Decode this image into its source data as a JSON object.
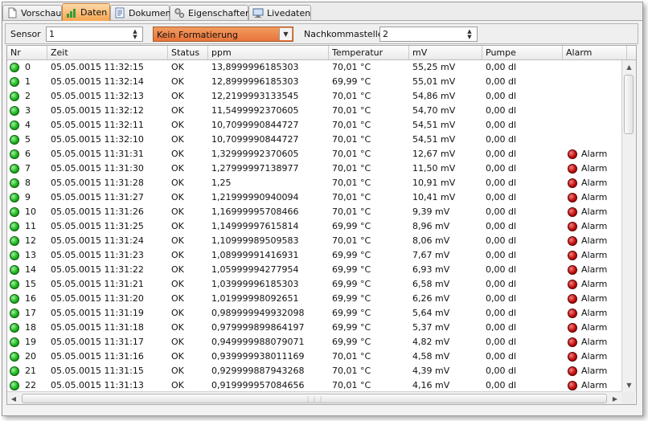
{
  "tabs": [
    {
      "label": "Vorschau",
      "icon": "document-icon"
    },
    {
      "label": "Daten",
      "icon": "bar-chart-icon",
      "active": true
    },
    {
      "label": "Dokument",
      "icon": "document-lines-icon"
    },
    {
      "label": "Eigenschaften",
      "icon": "gears-icon"
    },
    {
      "label": "Livedaten",
      "icon": "monitor-icon"
    }
  ],
  "toolbar": {
    "sensor_label": "Sensor",
    "sensor_value": "1",
    "format_value": "Kein Formatierung",
    "decimals_label": "Nachkommastellen",
    "decimals_value": "2"
  },
  "columns": [
    "Nr",
    "Zeit",
    "Status",
    "ppm",
    "Temperatur",
    "mV",
    "Pumpe",
    "Alarm"
  ],
  "rows": [
    {
      "nr": "0",
      "zeit": "05.05.0015 11:32:15",
      "status": "OK",
      "ppm": "13,8999996185303",
      "temp": "70,01 °C",
      "mv": "55,25 mV",
      "pumpe": "0,00 dl",
      "alarm": ""
    },
    {
      "nr": "1",
      "zeit": "05.05.0015 11:32:14",
      "status": "OK",
      "ppm": "12,8999996185303",
      "temp": "69,99 °C",
      "mv": "55,01 mV",
      "pumpe": "0,00 dl",
      "alarm": ""
    },
    {
      "nr": "2",
      "zeit": "05.05.0015 11:32:13",
      "status": "OK",
      "ppm": "12,2199993133545",
      "temp": "70,01 °C",
      "mv": "54,86 mV",
      "pumpe": "0,00 dl",
      "alarm": ""
    },
    {
      "nr": "3",
      "zeit": "05.05.0015 11:32:12",
      "status": "OK",
      "ppm": "11,5499992370605",
      "temp": "70,01 °C",
      "mv": "54,70 mV",
      "pumpe": "0,00 dl",
      "alarm": ""
    },
    {
      "nr": "4",
      "zeit": "05.05.0015 11:32:11",
      "status": "OK",
      "ppm": "10,7099990844727",
      "temp": "70,01 °C",
      "mv": "54,51 mV",
      "pumpe": "0,00 dl",
      "alarm": ""
    },
    {
      "nr": "5",
      "zeit": "05.05.0015 11:32:10",
      "status": "OK",
      "ppm": "10,7099990844727",
      "temp": "70,01 °C",
      "mv": "54,51 mV",
      "pumpe": "0,00 dl",
      "alarm": ""
    },
    {
      "nr": "6",
      "zeit": "05.05.0015 11:31:31",
      "status": "OK",
      "ppm": "1,32999992370605",
      "temp": "70,01 °C",
      "mv": "12,67 mV",
      "pumpe": "0,00 dl",
      "alarm": "Alarm"
    },
    {
      "nr": "7",
      "zeit": "05.05.0015 11:31:30",
      "status": "OK",
      "ppm": "1,27999997138977",
      "temp": "70,01 °C",
      "mv": "11,50 mV",
      "pumpe": "0,00 dl",
      "alarm": "Alarm"
    },
    {
      "nr": "8",
      "zeit": "05.05.0015 11:31:28",
      "status": "OK",
      "ppm": "1,25",
      "temp": "70,01 °C",
      "mv": "10,91 mV",
      "pumpe": "0,00 dl",
      "alarm": "Alarm"
    },
    {
      "nr": "9",
      "zeit": "05.05.0015 11:31:27",
      "status": "OK",
      "ppm": "1,21999990940094",
      "temp": "70,01 °C",
      "mv": "10,41 mV",
      "pumpe": "0,00 dl",
      "alarm": "Alarm"
    },
    {
      "nr": "10",
      "zeit": "05.05.0015 11:31:26",
      "status": "OK",
      "ppm": "1,16999995708466",
      "temp": "70,01 °C",
      "mv": "9,39 mV",
      "pumpe": "0,00 dl",
      "alarm": "Alarm"
    },
    {
      "nr": "11",
      "zeit": "05.05.0015 11:31:25",
      "status": "OK",
      "ppm": "1,14999997615814",
      "temp": "69,99 °C",
      "mv": "8,96 mV",
      "pumpe": "0,00 dl",
      "alarm": "Alarm"
    },
    {
      "nr": "12",
      "zeit": "05.05.0015 11:31:24",
      "status": "OK",
      "ppm": "1,10999989509583",
      "temp": "70,01 °C",
      "mv": "8,06 mV",
      "pumpe": "0,00 dl",
      "alarm": "Alarm"
    },
    {
      "nr": "13",
      "zeit": "05.05.0015 11:31:23",
      "status": "OK",
      "ppm": "1,08999991416931",
      "temp": "69,99 °C",
      "mv": "7,67 mV",
      "pumpe": "0,00 dl",
      "alarm": "Alarm"
    },
    {
      "nr": "14",
      "zeit": "05.05.0015 11:31:22",
      "status": "OK",
      "ppm": "1,05999994277954",
      "temp": "69,99 °C",
      "mv": "6,93 mV",
      "pumpe": "0,00 dl",
      "alarm": "Alarm"
    },
    {
      "nr": "15",
      "zeit": "05.05.0015 11:31:21",
      "status": "OK",
      "ppm": "1,03999996185303",
      "temp": "69,99 °C",
      "mv": "6,58 mV",
      "pumpe": "0,00 dl",
      "alarm": "Alarm"
    },
    {
      "nr": "16",
      "zeit": "05.05.0015 11:31:20",
      "status": "OK",
      "ppm": "1,01999998092651",
      "temp": "69,99 °C",
      "mv": "6,26 mV",
      "pumpe": "0,00 dl",
      "alarm": "Alarm"
    },
    {
      "nr": "17",
      "zeit": "05.05.0015 11:31:19",
      "status": "OK",
      "ppm": "0,989999949932098",
      "temp": "69,99 °C",
      "mv": "5,64 mV",
      "pumpe": "0,00 dl",
      "alarm": "Alarm"
    },
    {
      "nr": "18",
      "zeit": "05.05.0015 11:31:18",
      "status": "OK",
      "ppm": "0,979999899864197",
      "temp": "69,99 °C",
      "mv": "5,37 mV",
      "pumpe": "0,00 dl",
      "alarm": "Alarm"
    },
    {
      "nr": "19",
      "zeit": "05.05.0015 11:31:17",
      "status": "OK",
      "ppm": "0,949999988079071",
      "temp": "69,99 °C",
      "mv": "4,82 mV",
      "pumpe": "0,00 dl",
      "alarm": "Alarm"
    },
    {
      "nr": "20",
      "zeit": "05.05.0015 11:31:16",
      "status": "OK",
      "ppm": "0,939999938011169",
      "temp": "70,01 °C",
      "mv": "4,58 mV",
      "pumpe": "0,00 dl",
      "alarm": "Alarm"
    },
    {
      "nr": "21",
      "zeit": "05.05.0015 11:31:15",
      "status": "OK",
      "ppm": "0,929999887943268",
      "temp": "70,01 °C",
      "mv": "4,39 mV",
      "pumpe": "0,00 dl",
      "alarm": "Alarm"
    },
    {
      "nr": "22",
      "zeit": "05.05.0015 11:31:13",
      "status": "OK",
      "ppm": "0,919999957084656",
      "temp": "70,01 °C",
      "mv": "4,16 mV",
      "pumpe": "0,00 dl",
      "alarm": "Alarm"
    }
  ],
  "colors": {
    "active_tab": "#f6a550",
    "combo": "#e8743a",
    "status_ok": "#1fb41f",
    "alarm": "#c40f0f"
  }
}
